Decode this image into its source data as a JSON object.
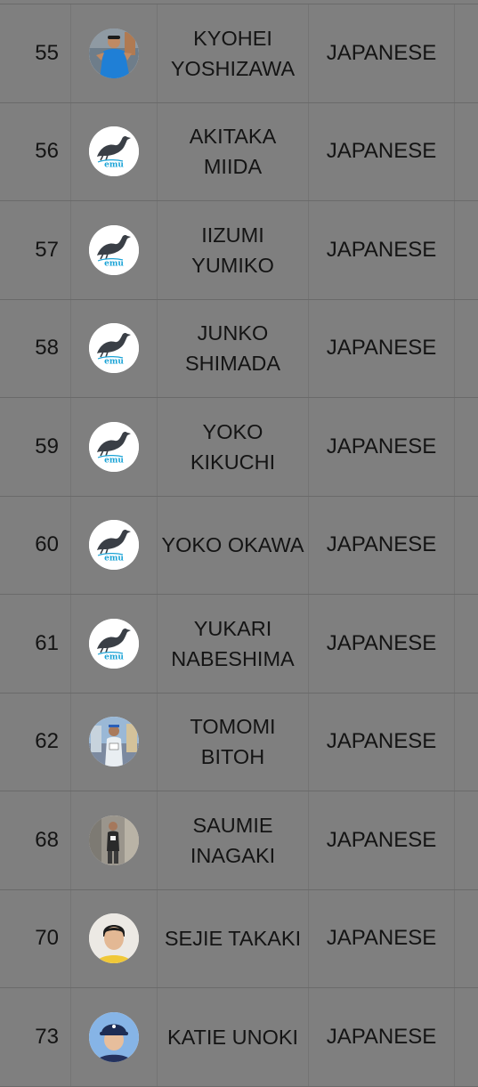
{
  "colors": {
    "background": "#7f7f7f",
    "divider": "#6a6a6a",
    "text": "#141414",
    "emu_logo_blue": "#1aa3d6"
  },
  "rows": [
    {
      "number": "55",
      "name": "KYOHEI YOSHIZAWA",
      "nationality": "JAPANESE",
      "avatar": "photo-runner-blue-shirt"
    },
    {
      "number": "56",
      "name": "AKITAKA MIIDA",
      "nationality": "JAPANESE",
      "avatar": "emu-logo",
      "logo_text": "emu"
    },
    {
      "number": "57",
      "name": "IIZUMI YUMIKO",
      "nationality": "JAPANESE",
      "avatar": "emu-logo",
      "logo_text": "emu"
    },
    {
      "number": "58",
      "name": "JUNKO SHIMADA",
      "nationality": "JAPANESE",
      "avatar": "emu-logo",
      "logo_text": "emu"
    },
    {
      "number": "59",
      "name": "YOKO KIKUCHI",
      "nationality": "JAPANESE",
      "avatar": "emu-logo",
      "logo_text": "emu"
    },
    {
      "number": "60",
      "name": "YOKO OKAWA",
      "nationality": "JAPANESE",
      "avatar": "emu-logo",
      "logo_text": "emu"
    },
    {
      "number": "61",
      "name": "YUKARI NABESHIMA",
      "nationality": "JAPANESE",
      "avatar": "emu-logo",
      "logo_text": "emu"
    },
    {
      "number": "62",
      "name": "TOMOMI BITOH",
      "nationality": "JAPANESE",
      "avatar": "photo-runner-race"
    },
    {
      "number": "68",
      "name": "SAUMIE INAGAKI",
      "nationality": "JAPANESE",
      "avatar": "photo-standing-person"
    },
    {
      "number": "70",
      "name": "SEJIE TAKAKI",
      "nationality": "JAPANESE",
      "avatar": "photo-portrait"
    },
    {
      "number": "73",
      "name": "KATIE UNOKI",
      "nationality": "JAPANESE",
      "avatar": "photo-portrait-cap"
    }
  ]
}
